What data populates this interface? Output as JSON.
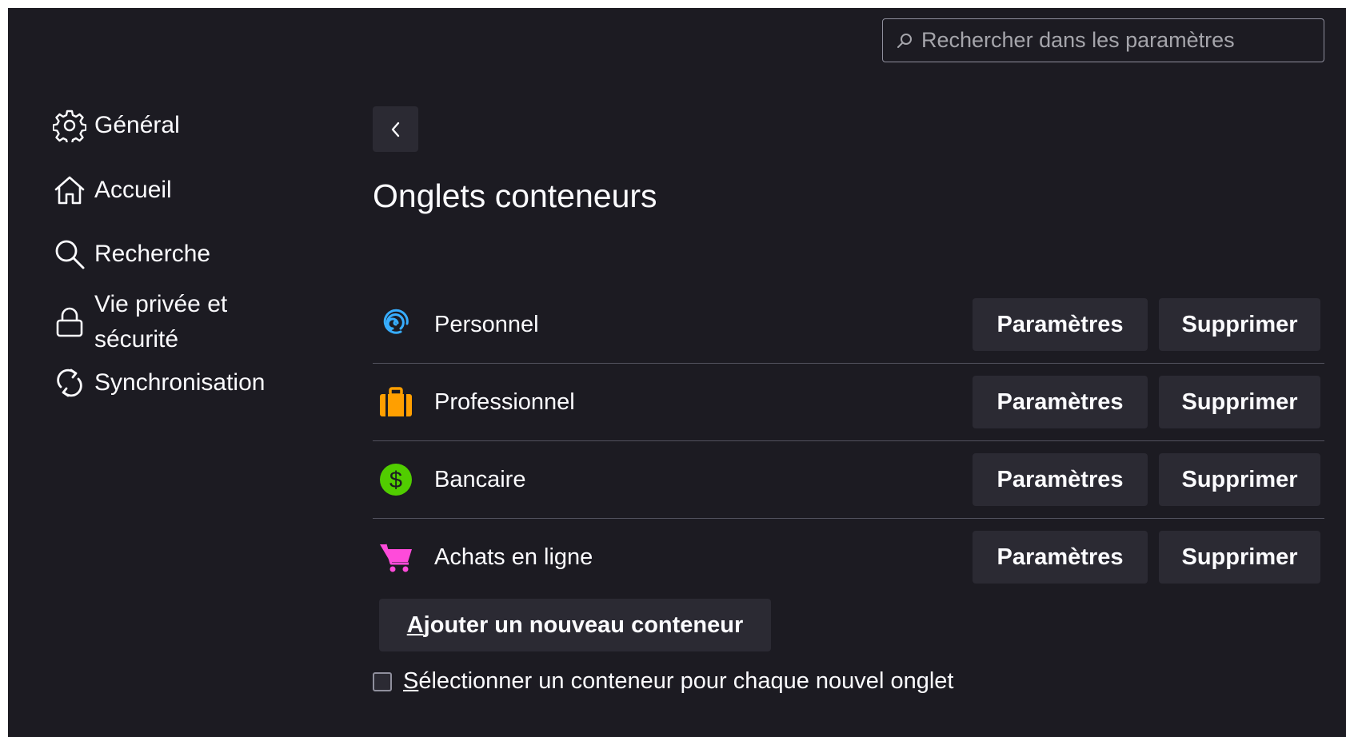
{
  "search": {
    "placeholder": "Rechercher dans les paramètres",
    "icon": "search-icon"
  },
  "sidebar": {
    "items": [
      {
        "label": "Général",
        "icon": "gear-icon"
      },
      {
        "label": "Accueil",
        "icon": "home-icon"
      },
      {
        "label": "Recherche",
        "icon": "search-icon"
      },
      {
        "label_line1": "Vie privée et",
        "label_line2": "sécurité",
        "icon": "lock-icon"
      },
      {
        "label": "Synchronisation",
        "icon": "sync-icon"
      }
    ]
  },
  "main": {
    "back_icon": "chevron-left-icon",
    "title": "Onglets conteneurs",
    "containers": [
      {
        "name": "Personnel",
        "icon": "fingerprint-icon",
        "color": "#37adff"
      },
      {
        "name": "Professionnel",
        "icon": "briefcase-icon",
        "color": "#ff9f00"
      },
      {
        "name": "Bancaire",
        "icon": "dollar-icon",
        "color": "#51cd00"
      },
      {
        "name": "Achats en ligne",
        "icon": "cart-icon",
        "color": "#ff4bda"
      }
    ],
    "settings_label": "Paramètres",
    "delete_label": "Supprimer",
    "add_button": {
      "accesskey": "A",
      "rest": "jouter un nouveau conteneur"
    },
    "checkbox": {
      "accesskey": "S",
      "rest": "électionner un conteneur pour chaque nouvel onglet",
      "checked": false
    }
  },
  "colors": {
    "background": "#1c1b22",
    "button": "#2b2a33",
    "text": "#fbfbfe",
    "separator": "#52525e"
  }
}
